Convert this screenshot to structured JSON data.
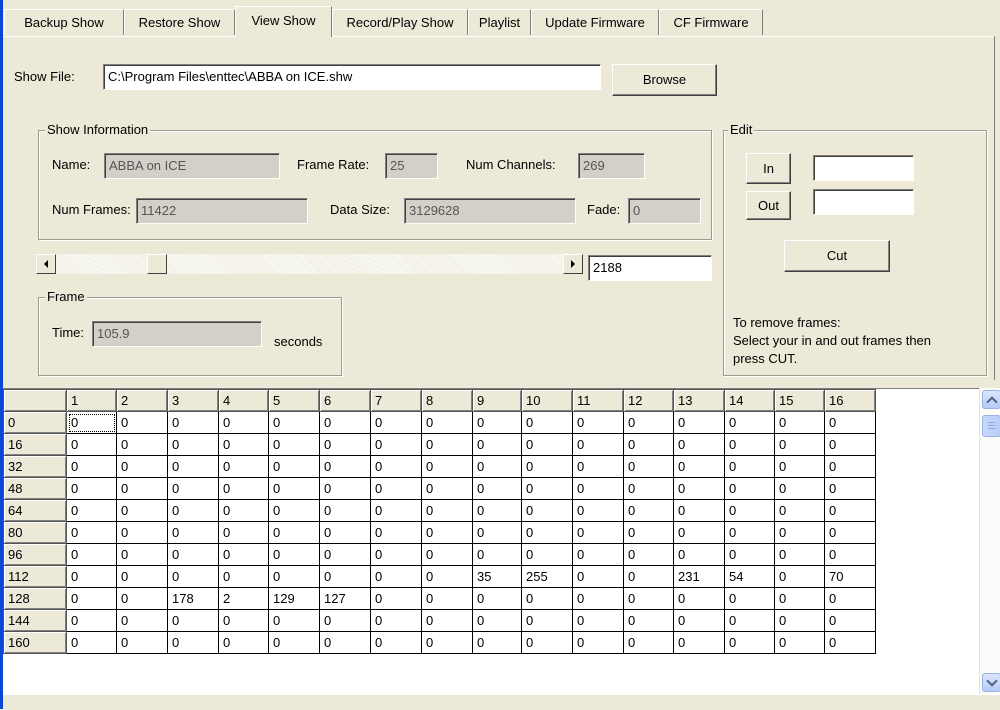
{
  "tabs": [
    {
      "label": "Backup Show"
    },
    {
      "label": "Restore Show"
    },
    {
      "label": "View Show"
    },
    {
      "label": "Record/Play Show"
    },
    {
      "label": "Playlist"
    },
    {
      "label": "Update Firmware"
    },
    {
      "label": "CF Firmware"
    }
  ],
  "active_tab": "View Show",
  "show_file": {
    "label": "Show File:",
    "value": "C:\\Program Files\\enttec\\ABBA on ICE.shw",
    "browse_label": "Browse"
  },
  "show_info": {
    "title": "Show Information",
    "name_label": "Name:",
    "name_value": "ABBA on ICE",
    "frame_rate_label": "Frame Rate:",
    "frame_rate_value": "25",
    "num_channels_label": "Num Channels:",
    "num_channels_value": "269",
    "num_frames_label": "Num Frames:",
    "num_frames_value": "11422",
    "data_size_label": "Data Size:",
    "data_size_value": "3129628",
    "fade_label": "Fade:",
    "fade_value": "0"
  },
  "scrubber": {
    "frame_value": "2188",
    "position_fraction": 0.19
  },
  "frame_group": {
    "title": "Frame",
    "time_label": "Time:",
    "time_value": "105.9",
    "unit": "seconds"
  },
  "edit_group": {
    "title": "Edit",
    "in_label": "In",
    "out_label": "Out",
    "in_value": "",
    "out_value": "",
    "cut_label": "Cut",
    "help_text": [
      "To remove frames:",
      "Select your in and out frames then",
      "press CUT."
    ]
  },
  "grid": {
    "columns": [
      "1",
      "2",
      "3",
      "4",
      "5",
      "6",
      "7",
      "8",
      "9",
      "10",
      "11",
      "12",
      "13",
      "14",
      "15",
      "16"
    ],
    "rows": [
      {
        "head": "0",
        "cells": [
          "0",
          "0",
          "0",
          "0",
          "0",
          "0",
          "0",
          "0",
          "0",
          "0",
          "0",
          "0",
          "0",
          "0",
          "0",
          "0"
        ]
      },
      {
        "head": "16",
        "cells": [
          "0",
          "0",
          "0",
          "0",
          "0",
          "0",
          "0",
          "0",
          "0",
          "0",
          "0",
          "0",
          "0",
          "0",
          "0",
          "0"
        ]
      },
      {
        "head": "32",
        "cells": [
          "0",
          "0",
          "0",
          "0",
          "0",
          "0",
          "0",
          "0",
          "0",
          "0",
          "0",
          "0",
          "0",
          "0",
          "0",
          "0"
        ]
      },
      {
        "head": "48",
        "cells": [
          "0",
          "0",
          "0",
          "0",
          "0",
          "0",
          "0",
          "0",
          "0",
          "0",
          "0",
          "0",
          "0",
          "0",
          "0",
          "0"
        ]
      },
      {
        "head": "64",
        "cells": [
          "0",
          "0",
          "0",
          "0",
          "0",
          "0",
          "0",
          "0",
          "0",
          "0",
          "0",
          "0",
          "0",
          "0",
          "0",
          "0"
        ]
      },
      {
        "head": "80",
        "cells": [
          "0",
          "0",
          "0",
          "0",
          "0",
          "0",
          "0",
          "0",
          "0",
          "0",
          "0",
          "0",
          "0",
          "0",
          "0",
          "0"
        ]
      },
      {
        "head": "96",
        "cells": [
          "0",
          "0",
          "0",
          "0",
          "0",
          "0",
          "0",
          "0",
          "0",
          "0",
          "0",
          "0",
          "0",
          "0",
          "0",
          "0"
        ]
      },
      {
        "head": "112",
        "cells": [
          "0",
          "0",
          "0",
          "0",
          "0",
          "0",
          "0",
          "0",
          "35",
          "255",
          "0",
          "0",
          "231",
          "54",
          "0",
          "70"
        ]
      },
      {
        "head": "128",
        "cells": [
          "0",
          "0",
          "178",
          "2",
          "129",
          "127",
          "0",
          "0",
          "0",
          "0",
          "0",
          "0",
          "0",
          "0",
          "0",
          "0"
        ]
      },
      {
        "head": "144",
        "cells": [
          "0",
          "0",
          "0",
          "0",
          "0",
          "0",
          "0",
          "0",
          "0",
          "0",
          "0",
          "0",
          "0",
          "0",
          "0",
          "0"
        ]
      },
      {
        "head": "160",
        "cells": [
          "0",
          "0",
          "0",
          "0",
          "0",
          "0",
          "0",
          "0",
          "0",
          "0",
          "0",
          "0",
          "0",
          "0",
          "0",
          "0"
        ]
      }
    ]
  }
}
